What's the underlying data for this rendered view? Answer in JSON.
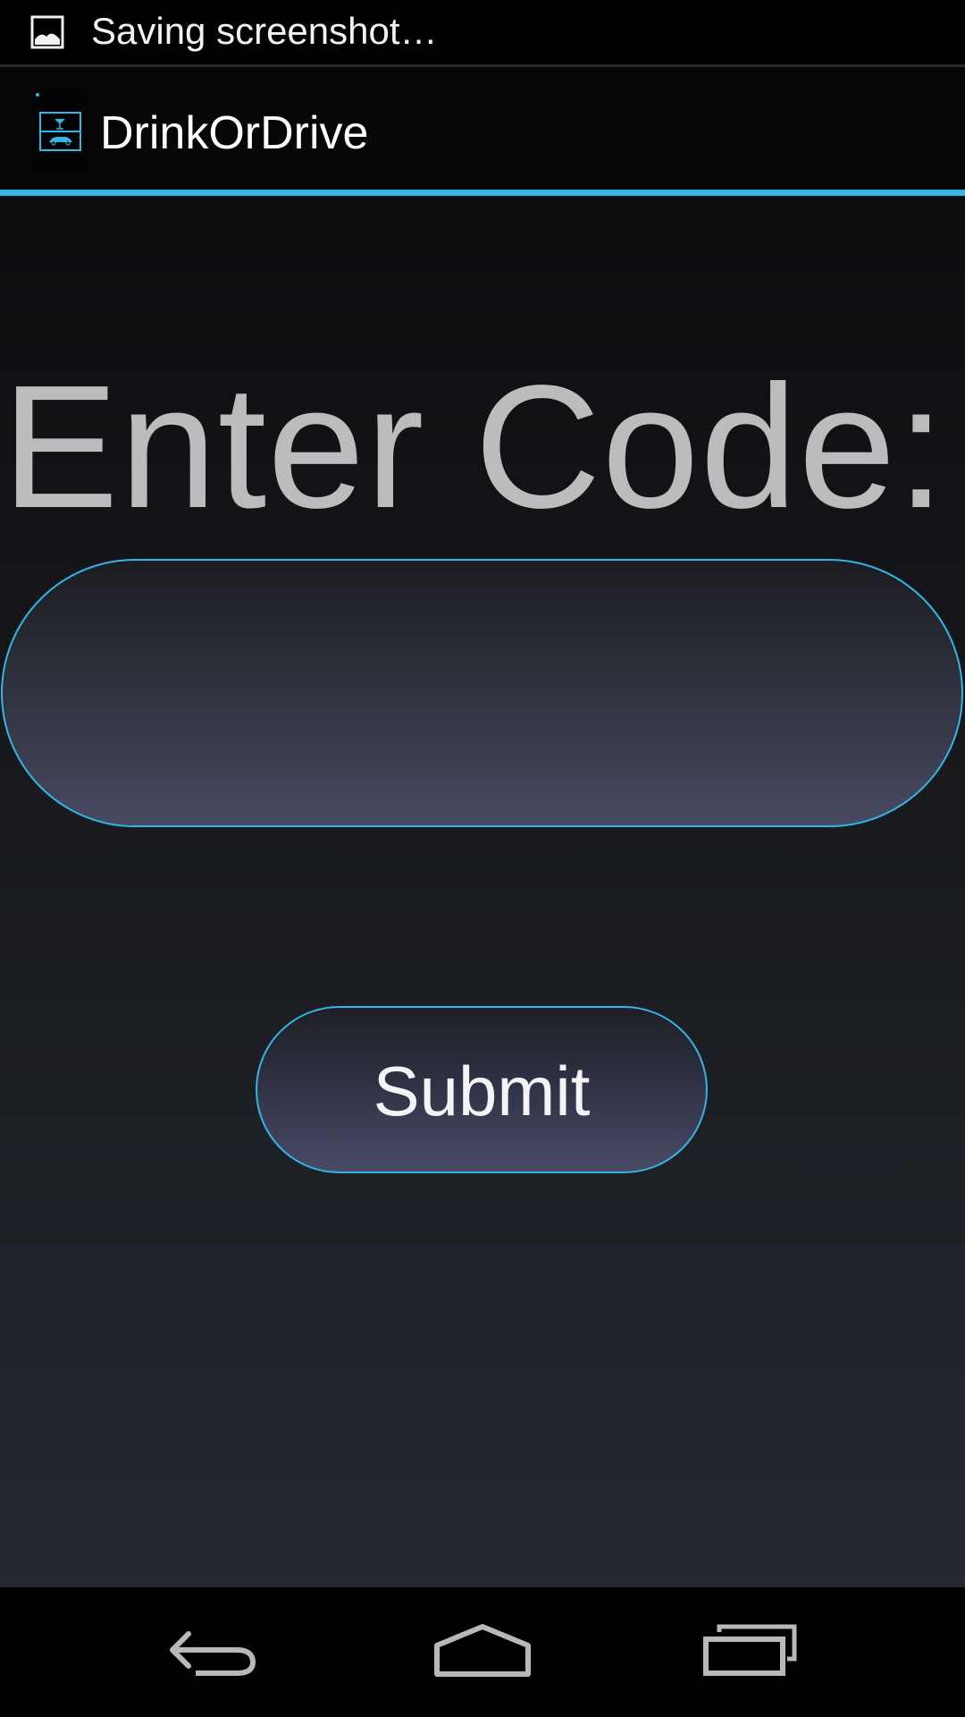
{
  "status_bar": {
    "notification_icon": "image-icon",
    "text": "Saving screenshot…"
  },
  "action_bar": {
    "app_icon": "drink-or-drive-app-icon",
    "title": "DrinkOrDrive",
    "accent_color": "#33b5e5"
  },
  "main": {
    "label": "Enter Code:",
    "code_input": {
      "value": "",
      "placeholder": ""
    },
    "submit_label": "Submit"
  },
  "nav_bar": {
    "back_icon": "back-icon",
    "home_icon": "home-icon",
    "recents_icon": "recent-apps-icon"
  },
  "colors": {
    "accent": "#33b5e5",
    "label_text": "#bcbcbd",
    "background_dark": "#0c0d0f",
    "field_fill_bottom": "#474a62"
  }
}
